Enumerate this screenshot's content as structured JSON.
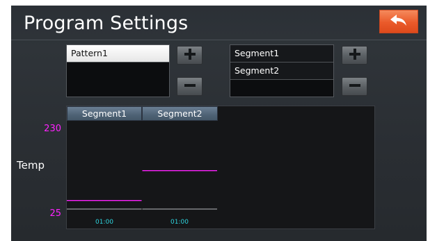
{
  "header": {
    "title": "Program Settings",
    "back_icon": "back-arrow-icon",
    "back_color": "#ea5a2a"
  },
  "patterns": {
    "items": [
      {
        "label": "Pattern1",
        "selected": true
      }
    ],
    "add_icon": "plus-icon",
    "remove_icon": "minus-icon"
  },
  "segments": {
    "items": [
      {
        "label": "Segment1"
      },
      {
        "label": "Segment2"
      }
    ],
    "add_icon": "plus-icon",
    "remove_icon": "minus-icon"
  },
  "chart": {
    "y_axis_label": "Temp",
    "y_max_label": "230",
    "y_min_label": "25",
    "segment_headers": [
      "Segment1",
      "Segment2"
    ],
    "segment_times": [
      "01:00",
      "01:00"
    ],
    "line_color": "#ff22ff",
    "time_color": "#2fd6e0"
  },
  "chart_data": {
    "type": "line",
    "ylabel": "Temp",
    "ylim": [
      25,
      230
    ],
    "segments": [
      {
        "name": "Segment1",
        "duration": "01:00",
        "temp": 45
      },
      {
        "name": "Segment2",
        "duration": "01:00",
        "temp": 115
      }
    ]
  }
}
